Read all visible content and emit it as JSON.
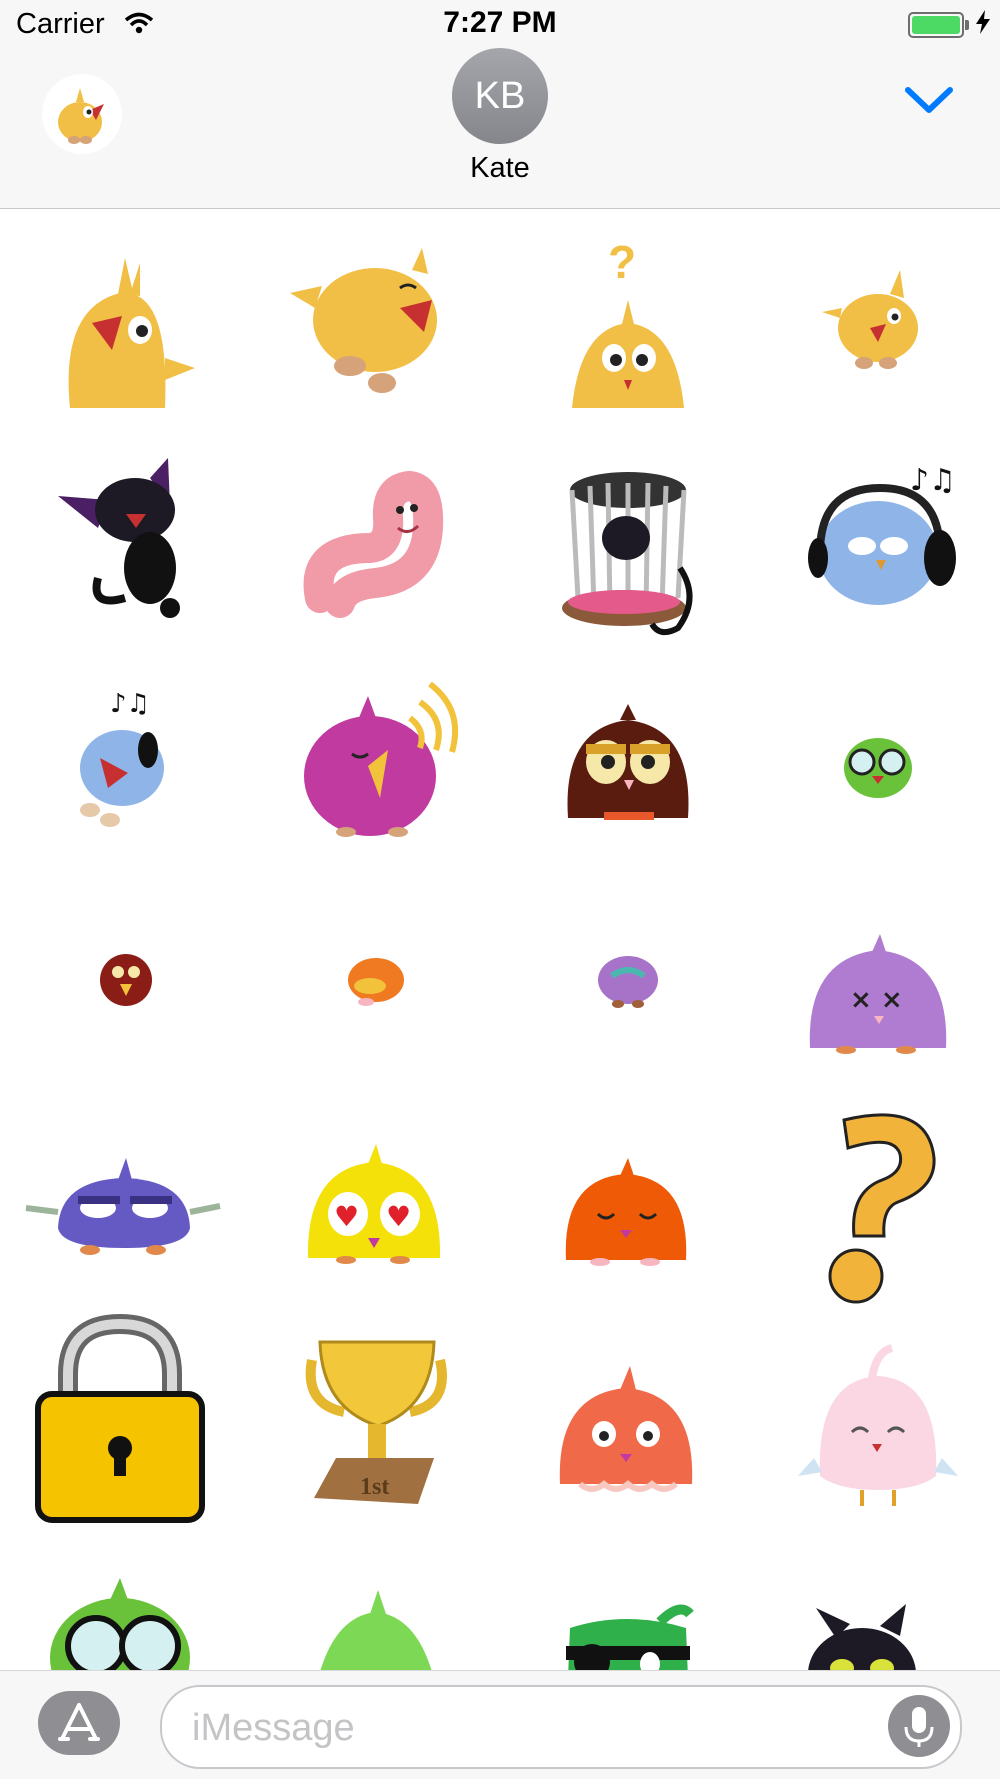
{
  "status_bar": {
    "carrier": "Carrier",
    "time": "7:27 PM",
    "battery_color": "#4cd964"
  },
  "header": {
    "app_icon": "yellow-chick-sticker-icon",
    "contact_initials": "KB",
    "contact_name": "Kate",
    "collapse_icon": "chevron-down-icon",
    "accent": "#007aff"
  },
  "stickers": [
    "yellow-chick-singing",
    "yellow-chick-flying",
    "yellow-chick-confused",
    "yellow-chick-small",
    "black-cat",
    "pink-worm",
    "caged-black-cat",
    "blue-bird-headphones",
    "blue-bird-music",
    "magenta-bird-singing",
    "brown-owl",
    "green-bird-glasses",
    "red-bird-small",
    "orange-bird-small",
    "purple-bird-small",
    "purple-bird-dizzy",
    "purple-bird-grumpy",
    "yellow-bird-hearts",
    "orange-bird-sleepy",
    "question-mark",
    "padlock",
    "trophy",
    "orange-bird-worried",
    "pink-bird-sad",
    "green-bird-glasses-partial",
    "green-bird-partial",
    "green-pirate-bird-partial",
    "black-cat-partial"
  ],
  "bottom_bar": {
    "app_store_icon": "app-store-icon",
    "message_placeholder": "iMessage",
    "mic_icon": "microphone-icon"
  }
}
